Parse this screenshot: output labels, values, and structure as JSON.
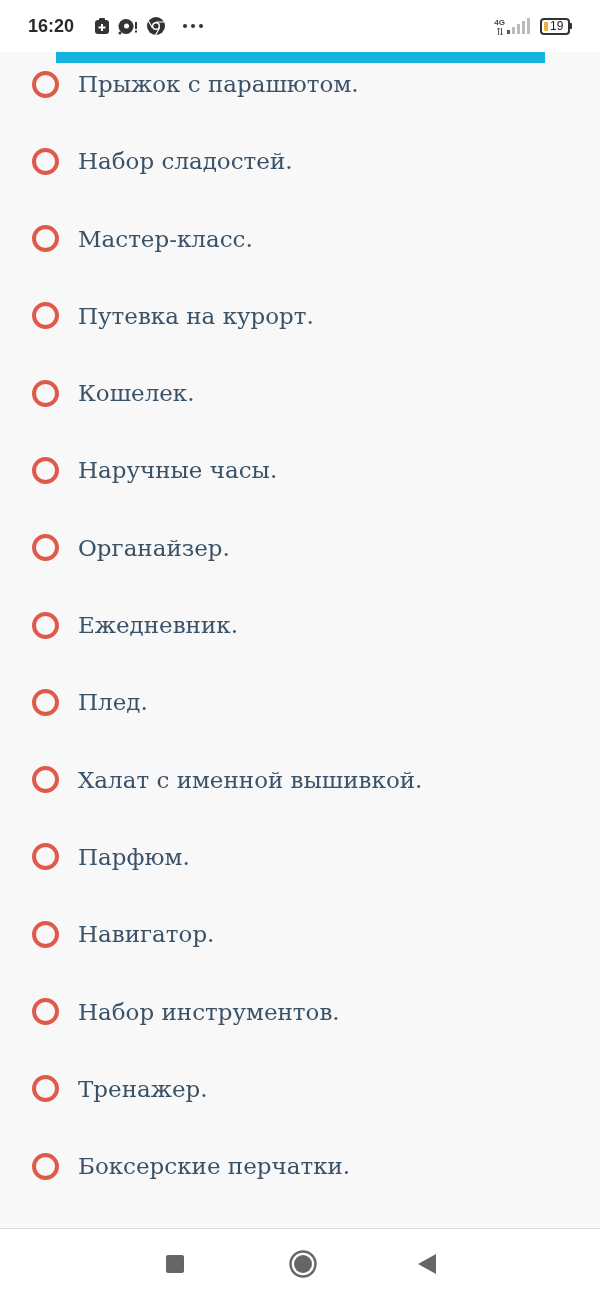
{
  "status_bar": {
    "time": "16:20",
    "network": "4G",
    "battery": "19"
  },
  "options": [
    {
      "label": "Прыжок с парашютом.",
      "selected": false
    },
    {
      "label": "Набор сладостей.",
      "selected": false
    },
    {
      "label": "Мастер-класс.",
      "selected": false
    },
    {
      "label": "Путевка на курорт.",
      "selected": false
    },
    {
      "label": "Кошелек.",
      "selected": false
    },
    {
      "label": "Наручные часы.",
      "selected": false
    },
    {
      "label": "Органайзер.",
      "selected": false
    },
    {
      "label": "Ежедневник.",
      "selected": false
    },
    {
      "label": "Плед.",
      "selected": false
    },
    {
      "label": "Халат с именной вышивкой.",
      "selected": false
    },
    {
      "label": "Парфюм.",
      "selected": false
    },
    {
      "label": "Навигатор.",
      "selected": false
    },
    {
      "label": "Набор инструментов.",
      "selected": false
    },
    {
      "label": "Тренажер.",
      "selected": false
    },
    {
      "label": "Боксерские перчатки.",
      "selected": false
    }
  ]
}
